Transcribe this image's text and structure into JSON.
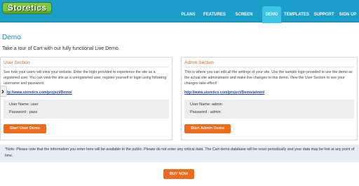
{
  "header": {
    "logo_text": "Storetics",
    "nav": [
      {
        "label": "PLANS"
      },
      {
        "label": "FEATURES"
      },
      {
        "label": "SCREEN SHOTS"
      },
      {
        "label": "DEMO",
        "active": true
      },
      {
        "label": "TEMPLATES"
      },
      {
        "label": "SUPPORT"
      },
      {
        "label": "SIGN UP"
      }
    ]
  },
  "page": {
    "title": "Demo",
    "intro": "Take a tour of Cart with our fully functional Live Demo."
  },
  "user_section": {
    "title": "User Section",
    "description": "See how your users will view your website. Enter the login provided to experience the site as a registered user. You can view the site as a unregistered user, register yourself or login using following username and password.",
    "link": "http://www.storetics.com/project/Demo/",
    "username_line": "User Name: user",
    "password_line": "Password : pass",
    "button": "Start User Demo"
  },
  "admin_section": {
    "title": "Admin Section",
    "description": "This is where you can edit all the settings of your site. Use the sample login provided to use the demo as the actual site administrator and make live changes to this demo. View the User Section to see your changes take effect!",
    "link": "http://www.storetics.com/project/Demo/admin/",
    "username_line": "User Name: admin",
    "password_line": "Password : admin",
    "button": "Start Admin Demo"
  },
  "note": "*Note: Please note that the information you enter here will be available to the public. Please do not enter any critical data. The Cart demo database will be reset periodically and your data may be lost at any point of time.",
  "buy_button": "BUY NOW",
  "colors": {
    "header_bg": "#1b9ec9",
    "active_tab": "#3cc3e8",
    "accent_orange": "#f06a1a",
    "note_bg": "#e3eff4"
  }
}
